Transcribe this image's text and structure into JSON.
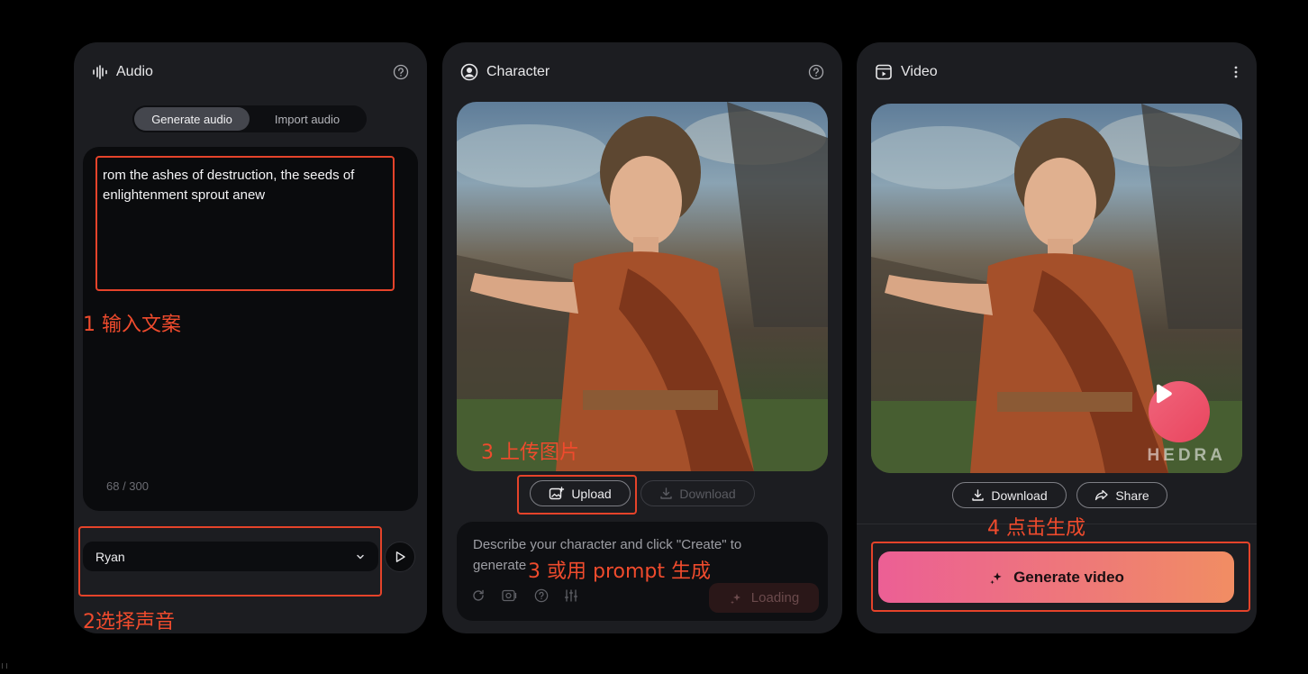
{
  "audio": {
    "title": "Audio",
    "tabs": [
      {
        "label": "Generate audio",
        "active": true
      },
      {
        "label": "Import audio",
        "active": false
      }
    ],
    "script_text": "rom the ashes of destruction, the seeds of enlightenment sprout anew",
    "char_count": "68 / 300",
    "voice": "Ryan"
  },
  "character": {
    "title": "Character",
    "upload_label": "Upload",
    "download_label": "Download",
    "prompt_placeholder": "Describe your character and click \"Create\" to generate",
    "loading_label": "Loading"
  },
  "video": {
    "title": "Video",
    "download_label": "Download",
    "share_label": "Share",
    "watermark": "HEDRA",
    "generate_label": "Generate video"
  },
  "annotations": {
    "step1": "1 输入文案",
    "step2": "2选择声音",
    "step3a": "3 上传图片",
    "step3b": "3 或用 prompt 生成",
    "step4": "4 点击生成"
  },
  "colors": {
    "accent_gradient_start": "#ec5f95",
    "accent_gradient_end": "#f18d63",
    "annotation_red": "#e5432a",
    "panel_bg": "#1c1d21"
  }
}
